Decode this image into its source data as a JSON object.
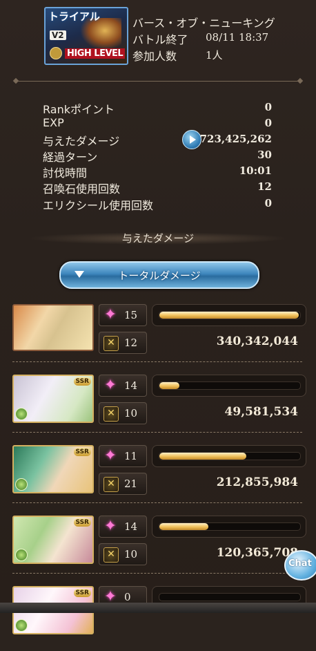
{
  "banner": {
    "title": "トライアル",
    "version": "V2",
    "level": "HIGH LEVEL"
  },
  "header": {
    "quest_name": "バース・オブ・ニューキング",
    "battle_end_label": "バトル終了",
    "battle_end_value": "08/11 18:37",
    "participants_label": "参加人数",
    "participants_value": "1人"
  },
  "stats": [
    {
      "label": "Rankポイント",
      "value": "0"
    },
    {
      "label": "EXP",
      "value": "0"
    },
    {
      "label": "与えたダメージ",
      "value": "723,425,262"
    },
    {
      "label": "経過ターン",
      "value": "30"
    },
    {
      "label": "討伐時間",
      "value": "10:01"
    },
    {
      "label": "召喚石使用回数",
      "value": "12"
    },
    {
      "label": "エリクシール使用回数",
      "value": "0"
    }
  ],
  "damage_section": {
    "title": "与えたダメージ",
    "dropdown_label": "トータルダメージ"
  },
  "characters": [
    {
      "skill_count": "15",
      "ca_count": "12",
      "damage": "340,342,044",
      "bar_fraction": 0.99,
      "ssr": ""
    },
    {
      "skill_count": "14",
      "ca_count": "10",
      "damage": "49,581,534",
      "bar_fraction": 0.14,
      "ssr": "SSR"
    },
    {
      "skill_count": "11",
      "ca_count": "21",
      "damage": "212,855,984",
      "bar_fraction": 0.62,
      "ssr": "SSR"
    },
    {
      "skill_count": "14",
      "ca_count": "10",
      "damage": "120,365,708",
      "bar_fraction": 0.35,
      "ssr": "SSR"
    },
    {
      "skill_count": "0",
      "ca_count": "",
      "damage": "",
      "bar_fraction": 0.0,
      "ssr": "SSR"
    }
  ],
  "chat_button": "Chat",
  "icons": {
    "skill": "pink-star-icon",
    "charge_attack": "charge-attack-icon",
    "play": "play-icon",
    "dropdown": "triangle-down-icon",
    "element": "wind-element-icon"
  }
}
